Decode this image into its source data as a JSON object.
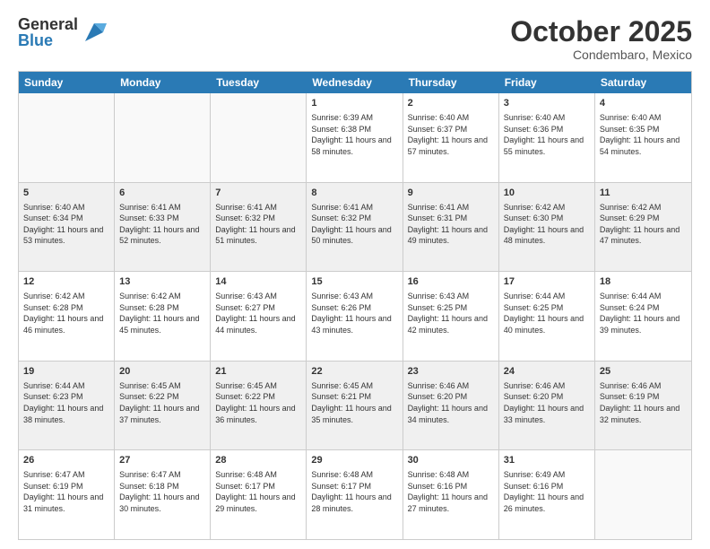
{
  "logo": {
    "general": "General",
    "blue": "Blue"
  },
  "header": {
    "month": "October 2025",
    "location": "Condembaro, Mexico"
  },
  "weekdays": [
    "Sunday",
    "Monday",
    "Tuesday",
    "Wednesday",
    "Thursday",
    "Friday",
    "Saturday"
  ],
  "rows": [
    [
      {
        "day": "",
        "sunrise": "",
        "sunset": "",
        "daylight": "",
        "empty": true
      },
      {
        "day": "",
        "sunrise": "",
        "sunset": "",
        "daylight": "",
        "empty": true
      },
      {
        "day": "",
        "sunrise": "",
        "sunset": "",
        "daylight": "",
        "empty": true
      },
      {
        "day": "1",
        "sunrise": "Sunrise: 6:39 AM",
        "sunset": "Sunset: 6:38 PM",
        "daylight": "Daylight: 11 hours and 58 minutes."
      },
      {
        "day": "2",
        "sunrise": "Sunrise: 6:40 AM",
        "sunset": "Sunset: 6:37 PM",
        "daylight": "Daylight: 11 hours and 57 minutes."
      },
      {
        "day": "3",
        "sunrise": "Sunrise: 6:40 AM",
        "sunset": "Sunset: 6:36 PM",
        "daylight": "Daylight: 11 hours and 55 minutes."
      },
      {
        "day": "4",
        "sunrise": "Sunrise: 6:40 AM",
        "sunset": "Sunset: 6:35 PM",
        "daylight": "Daylight: 11 hours and 54 minutes."
      }
    ],
    [
      {
        "day": "5",
        "sunrise": "Sunrise: 6:40 AM",
        "sunset": "Sunset: 6:34 PM",
        "daylight": "Daylight: 11 hours and 53 minutes."
      },
      {
        "day": "6",
        "sunrise": "Sunrise: 6:41 AM",
        "sunset": "Sunset: 6:33 PM",
        "daylight": "Daylight: 11 hours and 52 minutes."
      },
      {
        "day": "7",
        "sunrise": "Sunrise: 6:41 AM",
        "sunset": "Sunset: 6:32 PM",
        "daylight": "Daylight: 11 hours and 51 minutes."
      },
      {
        "day": "8",
        "sunrise": "Sunrise: 6:41 AM",
        "sunset": "Sunset: 6:32 PM",
        "daylight": "Daylight: 11 hours and 50 minutes."
      },
      {
        "day": "9",
        "sunrise": "Sunrise: 6:41 AM",
        "sunset": "Sunset: 6:31 PM",
        "daylight": "Daylight: 11 hours and 49 minutes."
      },
      {
        "day": "10",
        "sunrise": "Sunrise: 6:42 AM",
        "sunset": "Sunset: 6:30 PM",
        "daylight": "Daylight: 11 hours and 48 minutes."
      },
      {
        "day": "11",
        "sunrise": "Sunrise: 6:42 AM",
        "sunset": "Sunset: 6:29 PM",
        "daylight": "Daylight: 11 hours and 47 minutes."
      }
    ],
    [
      {
        "day": "12",
        "sunrise": "Sunrise: 6:42 AM",
        "sunset": "Sunset: 6:28 PM",
        "daylight": "Daylight: 11 hours and 46 minutes."
      },
      {
        "day": "13",
        "sunrise": "Sunrise: 6:42 AM",
        "sunset": "Sunset: 6:28 PM",
        "daylight": "Daylight: 11 hours and 45 minutes."
      },
      {
        "day": "14",
        "sunrise": "Sunrise: 6:43 AM",
        "sunset": "Sunset: 6:27 PM",
        "daylight": "Daylight: 11 hours and 44 minutes."
      },
      {
        "day": "15",
        "sunrise": "Sunrise: 6:43 AM",
        "sunset": "Sunset: 6:26 PM",
        "daylight": "Daylight: 11 hours and 43 minutes."
      },
      {
        "day": "16",
        "sunrise": "Sunrise: 6:43 AM",
        "sunset": "Sunset: 6:25 PM",
        "daylight": "Daylight: 11 hours and 42 minutes."
      },
      {
        "day": "17",
        "sunrise": "Sunrise: 6:44 AM",
        "sunset": "Sunset: 6:25 PM",
        "daylight": "Daylight: 11 hours and 40 minutes."
      },
      {
        "day": "18",
        "sunrise": "Sunrise: 6:44 AM",
        "sunset": "Sunset: 6:24 PM",
        "daylight": "Daylight: 11 hours and 39 minutes."
      }
    ],
    [
      {
        "day": "19",
        "sunrise": "Sunrise: 6:44 AM",
        "sunset": "Sunset: 6:23 PM",
        "daylight": "Daylight: 11 hours and 38 minutes."
      },
      {
        "day": "20",
        "sunrise": "Sunrise: 6:45 AM",
        "sunset": "Sunset: 6:22 PM",
        "daylight": "Daylight: 11 hours and 37 minutes."
      },
      {
        "day": "21",
        "sunrise": "Sunrise: 6:45 AM",
        "sunset": "Sunset: 6:22 PM",
        "daylight": "Daylight: 11 hours and 36 minutes."
      },
      {
        "day": "22",
        "sunrise": "Sunrise: 6:45 AM",
        "sunset": "Sunset: 6:21 PM",
        "daylight": "Daylight: 11 hours and 35 minutes."
      },
      {
        "day": "23",
        "sunrise": "Sunrise: 6:46 AM",
        "sunset": "Sunset: 6:20 PM",
        "daylight": "Daylight: 11 hours and 34 minutes."
      },
      {
        "day": "24",
        "sunrise": "Sunrise: 6:46 AM",
        "sunset": "Sunset: 6:20 PM",
        "daylight": "Daylight: 11 hours and 33 minutes."
      },
      {
        "day": "25",
        "sunrise": "Sunrise: 6:46 AM",
        "sunset": "Sunset: 6:19 PM",
        "daylight": "Daylight: 11 hours and 32 minutes."
      }
    ],
    [
      {
        "day": "26",
        "sunrise": "Sunrise: 6:47 AM",
        "sunset": "Sunset: 6:19 PM",
        "daylight": "Daylight: 11 hours and 31 minutes."
      },
      {
        "day": "27",
        "sunrise": "Sunrise: 6:47 AM",
        "sunset": "Sunset: 6:18 PM",
        "daylight": "Daylight: 11 hours and 30 minutes."
      },
      {
        "day": "28",
        "sunrise": "Sunrise: 6:48 AM",
        "sunset": "Sunset: 6:17 PM",
        "daylight": "Daylight: 11 hours and 29 minutes."
      },
      {
        "day": "29",
        "sunrise": "Sunrise: 6:48 AM",
        "sunset": "Sunset: 6:17 PM",
        "daylight": "Daylight: 11 hours and 28 minutes."
      },
      {
        "day": "30",
        "sunrise": "Sunrise: 6:48 AM",
        "sunset": "Sunset: 6:16 PM",
        "daylight": "Daylight: 11 hours and 27 minutes."
      },
      {
        "day": "31",
        "sunrise": "Sunrise: 6:49 AM",
        "sunset": "Sunset: 6:16 PM",
        "daylight": "Daylight: 11 hours and 26 minutes."
      },
      {
        "day": "",
        "sunrise": "",
        "sunset": "",
        "daylight": "",
        "empty": true
      }
    ]
  ]
}
